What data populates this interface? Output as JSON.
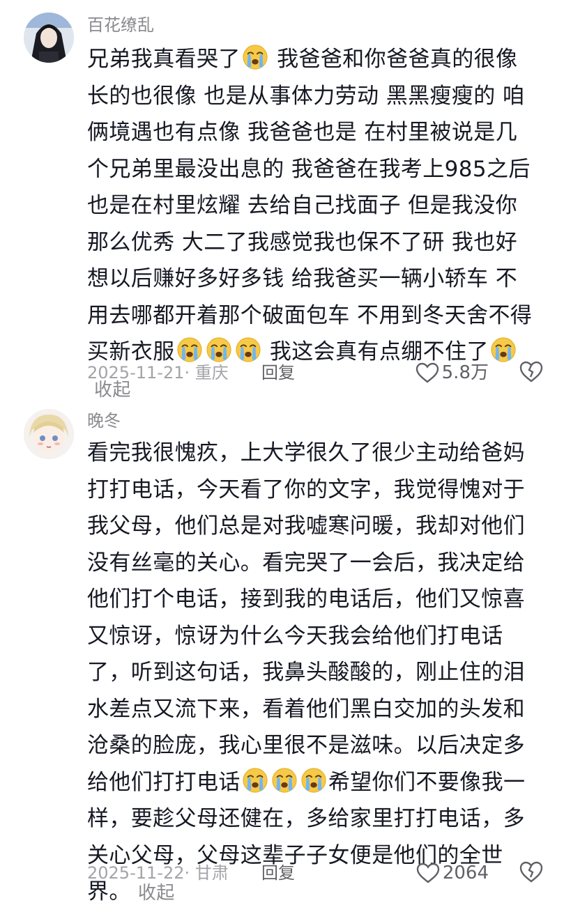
{
  "comments": [
    {
      "username": "百花缭乱",
      "avatar_icon": "anime-avatar-dark-hair",
      "segments": [
        {
          "t": "text",
          "v": "兄弟我真看哭了"
        },
        {
          "t": "emoji",
          "name": "crying-emoji"
        },
        {
          "t": "text",
          "v": " 我爸爸和你爸爸真的很像 长的也很像 也是从事体力劳动 黑黑瘦瘦的 咱俩境遇也有点像 我爸爸也是 在村里被说是几个兄弟里最没出息的 我爸爸在我考上985之后也是在村里炫耀 去给自己找面子 但是我没你那么优秀 大二了我感觉我也保不了研 我也好想以后赚好多好多钱 给我爸买一辆小轿车 不用去哪都开着那个破面包车 不用到冬天舍不得买新衣服"
        },
        {
          "t": "emoji",
          "name": "crying-emoji"
        },
        {
          "t": "emoji",
          "name": "crying-emoji"
        },
        {
          "t": "emoji",
          "name": "crying-emoji"
        },
        {
          "t": "text",
          "v": " 我这会真有点绷不住了"
        },
        {
          "t": "emoji",
          "name": "crying-emoji"
        }
      ],
      "collapse_label": "收起",
      "date_location": "2025-11-21· 重庆",
      "reply_label": "回复",
      "like_count": "5.8万"
    },
    {
      "username": "晚冬",
      "avatar_icon": "anime-avatar-blonde",
      "segments": [
        {
          "t": "text",
          "v": "看完我很愧疚，上大学很久了很少主动给爸妈打打电话，今天看了你的文字，我觉得愧对于我父母，他们总是对我嘘寒问暖，我却对他们没有丝毫的关心。看完哭了一会后，我决定给他们打个电话，接到我的电话后，他们又惊喜又惊讶，惊讶为什么今天我会给他们打电话了，听到这句话，我鼻头酸酸的，刚止住的泪水差点又流下来，看着他们黑白交加的头发和沧桑的脸庞，我心里很不是滋味。以后决定多给他们打打电话"
        },
        {
          "t": "emoji",
          "name": "crying-emoji"
        },
        {
          "t": "emoji",
          "name": "crying-emoji"
        },
        {
          "t": "emoji",
          "name": "crying-emoji"
        },
        {
          "t": "text",
          "v": "希望你们不要像我一样，要趁父母还健在，多给家里打打电话，多关心父母，父母这辈子子女便是他们的全世界。"
        }
      ],
      "collapse_label": "收起",
      "date_location": "2025-11-22· 甘肃",
      "reply_label": "回复",
      "like_count": "2064"
    }
  ],
  "colors": {
    "text": "#161823",
    "secondary": "#8a8a8f",
    "meta": "#a3a3a8"
  }
}
